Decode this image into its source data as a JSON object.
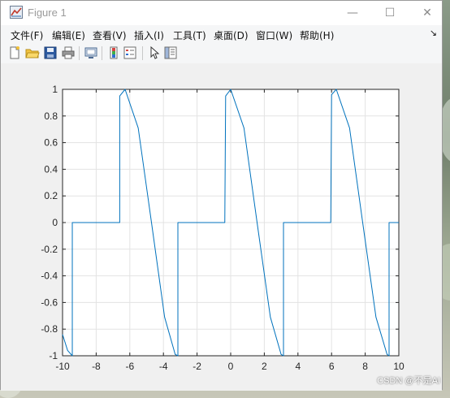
{
  "window": {
    "title": "Figure 1"
  },
  "controls": {
    "minimize": "—",
    "maximize": "☐",
    "close": "✕"
  },
  "menu": {
    "items": [
      "文件(F)",
      "编辑(E)",
      "查看(V)",
      "插入(I)",
      "工具(T)",
      "桌面(D)",
      "窗口(W)",
      "帮助(H)"
    ],
    "overflow": "↘"
  },
  "toolbar": {
    "buttons": [
      "new-figure-icon",
      "open-file-icon",
      "save-icon",
      "print-icon",
      "link-plot-icon",
      "insert-colorbar-icon",
      "insert-legend-icon",
      "edit-plot-arrow-icon",
      "property-inspector-icon"
    ]
  },
  "chart_data": {
    "type": "line",
    "title": "",
    "xlabel": "",
    "ylabel": "",
    "xlim": [
      -10,
      10
    ],
    "ylim": [
      -1,
      1
    ],
    "grid": true,
    "xticks": [
      "-10",
      "-8",
      "-6",
      "-4",
      "-2",
      "0",
      "2",
      "4",
      "6",
      "8",
      "10"
    ],
    "yticks": [
      "1",
      "0.8",
      "0.6",
      "0.4",
      "0.2",
      "0",
      "-0.2",
      "-0.4",
      "-0.6",
      "-0.8",
      "-1"
    ],
    "line_color": "#0072bd",
    "series": [
      {
        "x": [
          -10,
          -9.7,
          -9.42,
          -9.42,
          -6.6,
          -6.6,
          -6.28,
          -5.5,
          -4.71,
          -3.93,
          -3.3,
          -3.14,
          -3.14,
          -0.35,
          -0.3,
          0,
          0.79,
          1.57,
          2.36,
          3.0,
          3.14,
          3.14,
          5.95,
          6.0,
          6.28,
          7.07,
          7.85,
          8.64,
          9.3,
          9.42,
          9.42,
          10
        ],
        "y": [
          -0.84,
          -0.96,
          -1,
          0,
          0,
          0.95,
          1,
          0.71,
          0,
          -0.71,
          -0.99,
          -1,
          0,
          0,
          0.95,
          1,
          0.71,
          0,
          -0.71,
          -0.99,
          -1,
          0,
          0,
          0.96,
          1,
          0.71,
          0,
          -0.71,
          -0.99,
          -1,
          0,
          0
        ]
      }
    ]
  },
  "watermark": "CSDN @不是AI"
}
